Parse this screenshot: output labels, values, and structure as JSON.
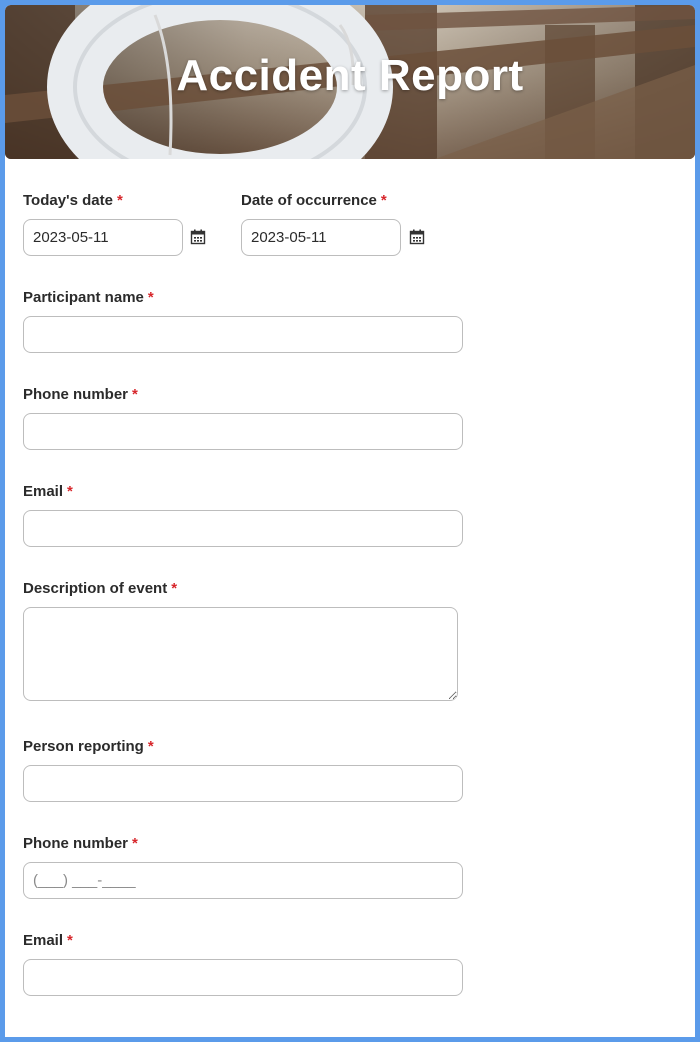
{
  "header": {
    "title": "Accident Report"
  },
  "fields": {
    "todays_date": {
      "label": "Today's date",
      "required": "*",
      "value": "2023-05-11"
    },
    "date_occurrence": {
      "label": "Date of occurrence",
      "required": "*",
      "value": "2023-05-11"
    },
    "participant_name": {
      "label": "Participant name",
      "required": "*",
      "value": ""
    },
    "participant_phone": {
      "label": "Phone number",
      "required": "*",
      "value": ""
    },
    "participant_email": {
      "label": "Email",
      "required": "*",
      "value": ""
    },
    "description": {
      "label": "Description of event",
      "required": "*",
      "value": ""
    },
    "person_reporting": {
      "label": "Person reporting",
      "required": "*",
      "value": ""
    },
    "reporter_phone": {
      "label": "Phone number",
      "required": "*",
      "placeholder": "(___) ___-____",
      "value": ""
    },
    "reporter_email": {
      "label": "Email",
      "required": "*",
      "value": ""
    }
  },
  "icons": {
    "date_picker": "calendar-icon"
  },
  "colors": {
    "accent_border": "#5b9bea",
    "required": "#d7262b",
    "field_border": "#bdbdbd"
  }
}
